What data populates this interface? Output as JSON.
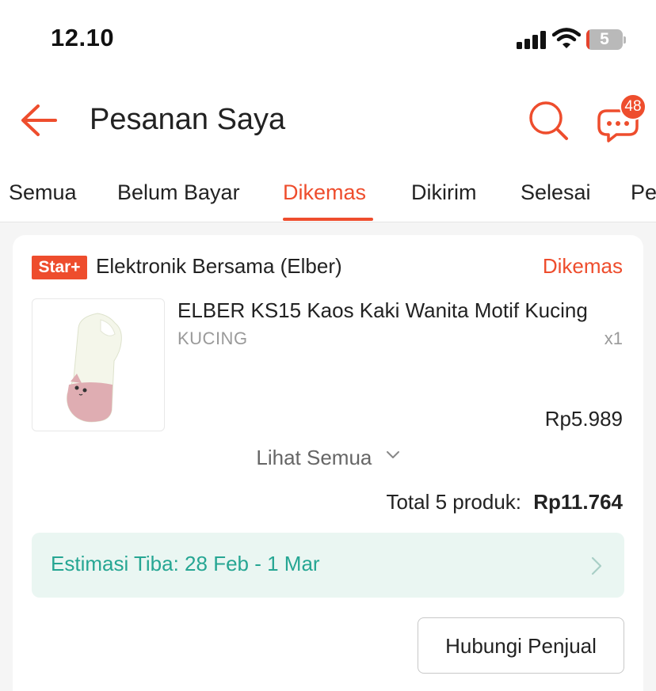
{
  "status_bar": {
    "time": "12.10",
    "battery_level": "5",
    "icons": [
      "signal-icon",
      "wifi-icon",
      "battery-icon"
    ]
  },
  "header": {
    "title": "Pesanan Saya",
    "chat_badge": "48",
    "icons": [
      "back-arrow-icon",
      "search-icon",
      "chat-icon"
    ]
  },
  "tabs": [
    {
      "label": "Semua"
    },
    {
      "label": "Belum Bayar"
    },
    {
      "label": "Dikemas",
      "active": true
    },
    {
      "label": "Dikirim"
    },
    {
      "label": "Selesai"
    },
    {
      "label": "Pe"
    }
  ],
  "order": {
    "shop_badge": "Star+",
    "shop_name": "Elektronik Bersama (Elber)",
    "status": "Dikemas",
    "product": {
      "name": "ELBER KS15 Kaos Kaki Wanita Motif Kucing",
      "variant": "KUCING",
      "quantity": "x1",
      "price": "Rp5.989"
    },
    "see_all_label": "Lihat Semua",
    "total_label": "Total 5 produk:",
    "total_amount": "Rp11.764",
    "eta_label": "Estimasi Tiba: 28 Feb - 1 Mar",
    "contact_label": "Hubungi Penjual"
  },
  "colors": {
    "accent": "#ee4d2d",
    "eta_text": "#26a693",
    "eta_bg": "#eaf6f2"
  }
}
